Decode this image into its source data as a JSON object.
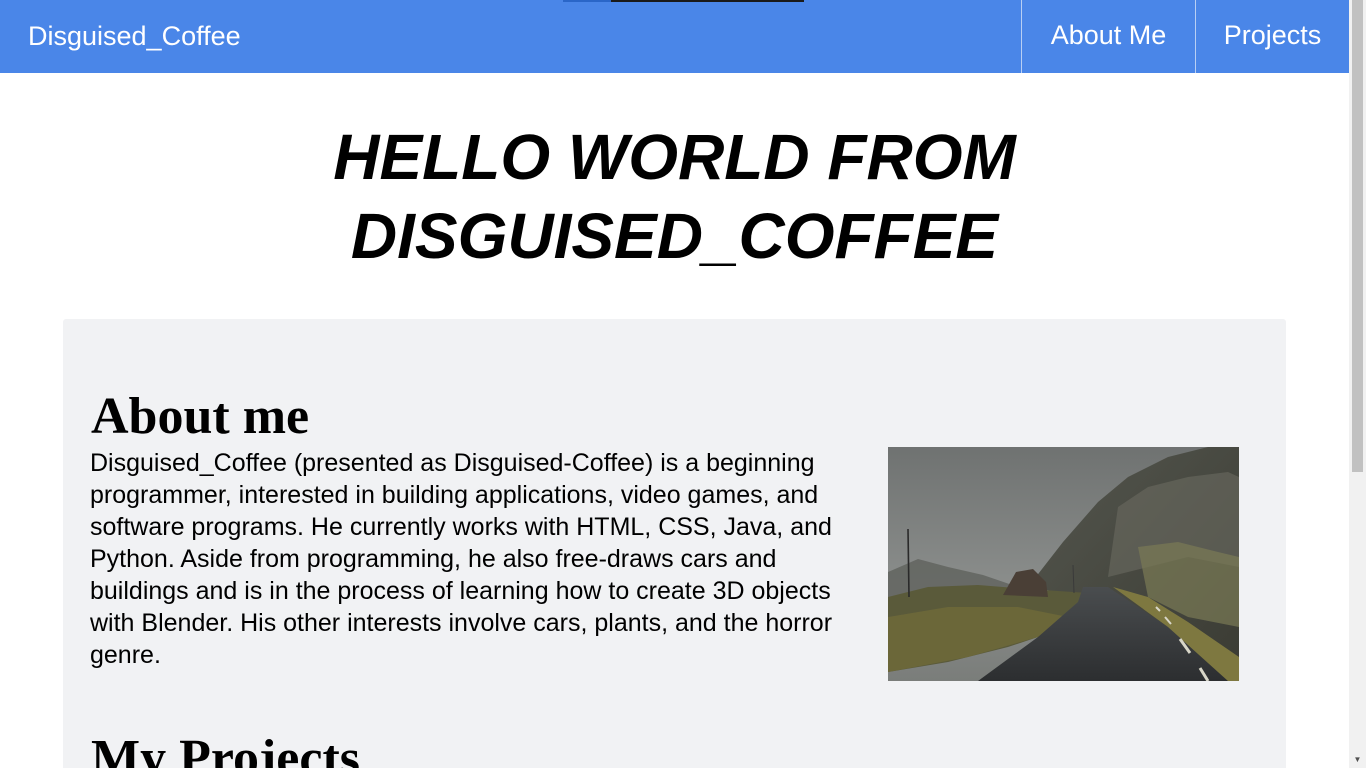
{
  "navbar": {
    "brand": "Disguised_Coffee",
    "links": [
      {
        "label": "About Me"
      },
      {
        "label": "Projects"
      }
    ],
    "color": "#4a86e8"
  },
  "hero": {
    "line1": "HELLO WORLD FROM",
    "line2": "DISGUISED_COFFEE"
  },
  "about": {
    "title": "About me",
    "text": "Disguised_Coffee (presented as Disguised-Coffee) is a beginning programmer, interested in building applications, video games, and software programs. He currently works with HTML, CSS, Java, and Python. Aside from programming, he also free-draws cars and buildings and is in the process of learning how to create 3D objects with Blender. His other interests involve cars, plants, and the horror genre.",
    "image_icon": "misty-mountain-road-photo"
  },
  "projects": {
    "title": "My Projects"
  },
  "scrollbar": {
    "down_arrow": "▼"
  }
}
